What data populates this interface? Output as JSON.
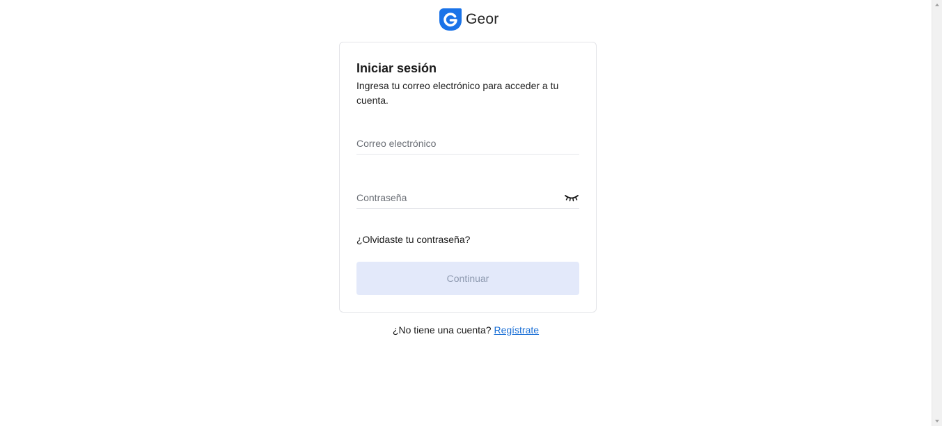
{
  "brand": {
    "name": "Geor",
    "logo_color": "#1a73e8"
  },
  "login": {
    "title": "Iniciar sesión",
    "subtitle": "Ingresa tu correo electrónico para acceder a tu cuenta.",
    "email_placeholder": "Correo electrónico",
    "email_value": "",
    "password_placeholder": "Contraseña",
    "password_value": "",
    "password_toggle_icon": "eye-closed-icon",
    "forgot_password": "¿Olvidaste tu contraseña?",
    "continue_label": "Continuar",
    "continue_disabled": true
  },
  "signup": {
    "prompt": "¿No tiene una cuenta?",
    "link": "Regístrate"
  },
  "colors": {
    "accent": "#1a73e8",
    "link": "#1a6fd6",
    "button_disabled_bg": "#e3e9fa",
    "button_disabled_text": "#8e9ab0"
  }
}
